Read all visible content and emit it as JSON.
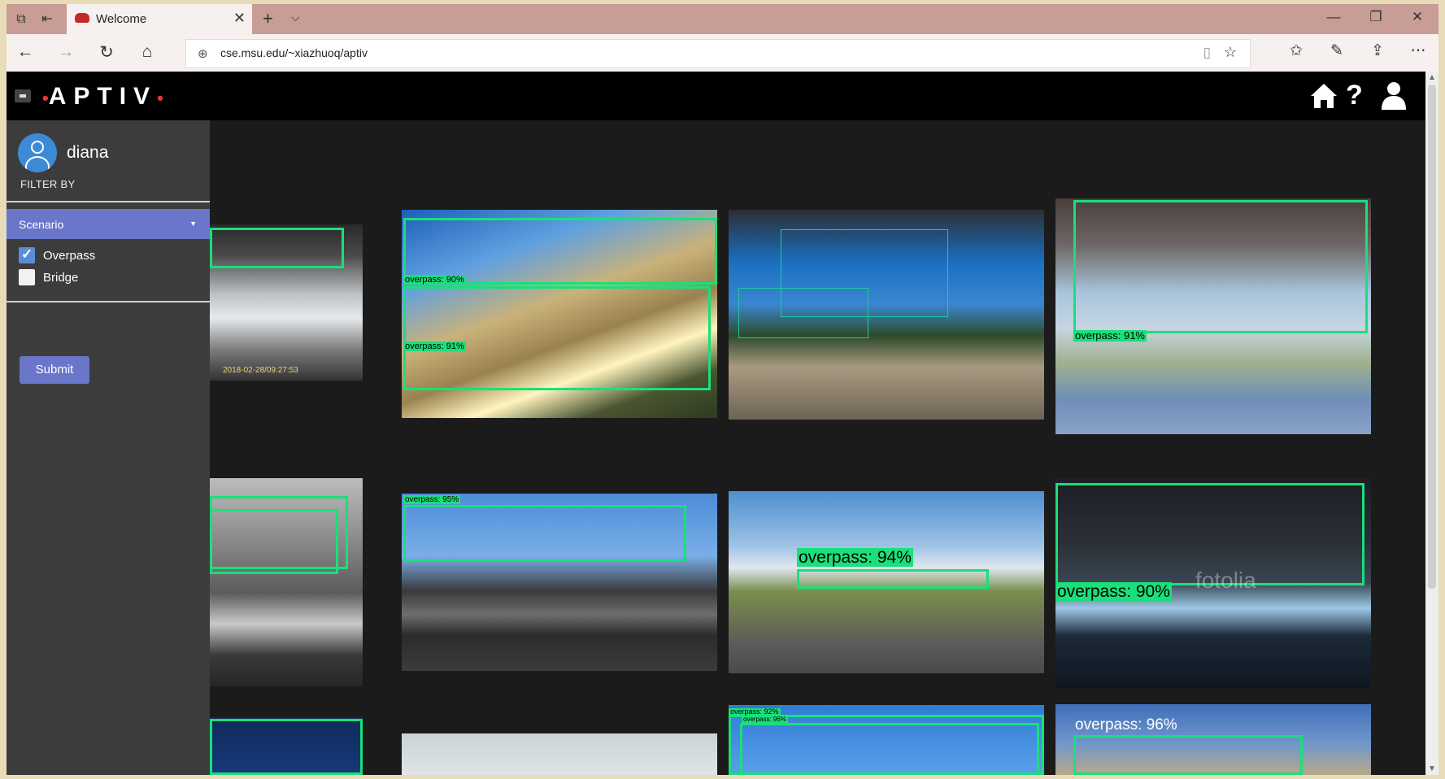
{
  "browser": {
    "tab_title": "Welcome",
    "url": "cse.msu.edu/~xiazhuoq/aptiv"
  },
  "app": {
    "logo_text": "APTIV",
    "header_icons": [
      "home-icon",
      "help-icon",
      "user-icon"
    ],
    "help_glyph": "?"
  },
  "sidebar": {
    "username": "diana",
    "filter_by": "FILTER BY",
    "scenario_label": "Scenario",
    "options": [
      {
        "label": "Overpass",
        "checked": true
      },
      {
        "label": "Bridge",
        "checked": false
      }
    ],
    "submit_label": "Submit"
  },
  "gallery": {
    "detections": [
      {
        "label": "overpass: 90%"
      },
      {
        "label": "overpass: 91%"
      },
      {
        "label": "overpass: 91%"
      },
      {
        "label": "overpass: 95%"
      },
      {
        "label": "overpass: 94%"
      },
      {
        "label": "overpass: 90%"
      },
      {
        "label": "overpass: 92%"
      },
      {
        "label": "overpass: 96%"
      },
      {
        "label": "overpass: 96%"
      }
    ],
    "timestamp": "2018-02-28/09:27:53",
    "watermark": "fotolia"
  },
  "colors": {
    "accent": "#6a76c9",
    "detection_box": "#19e07a",
    "sidebar_bg": "#3c3c3c",
    "header_bg": "#000000"
  }
}
